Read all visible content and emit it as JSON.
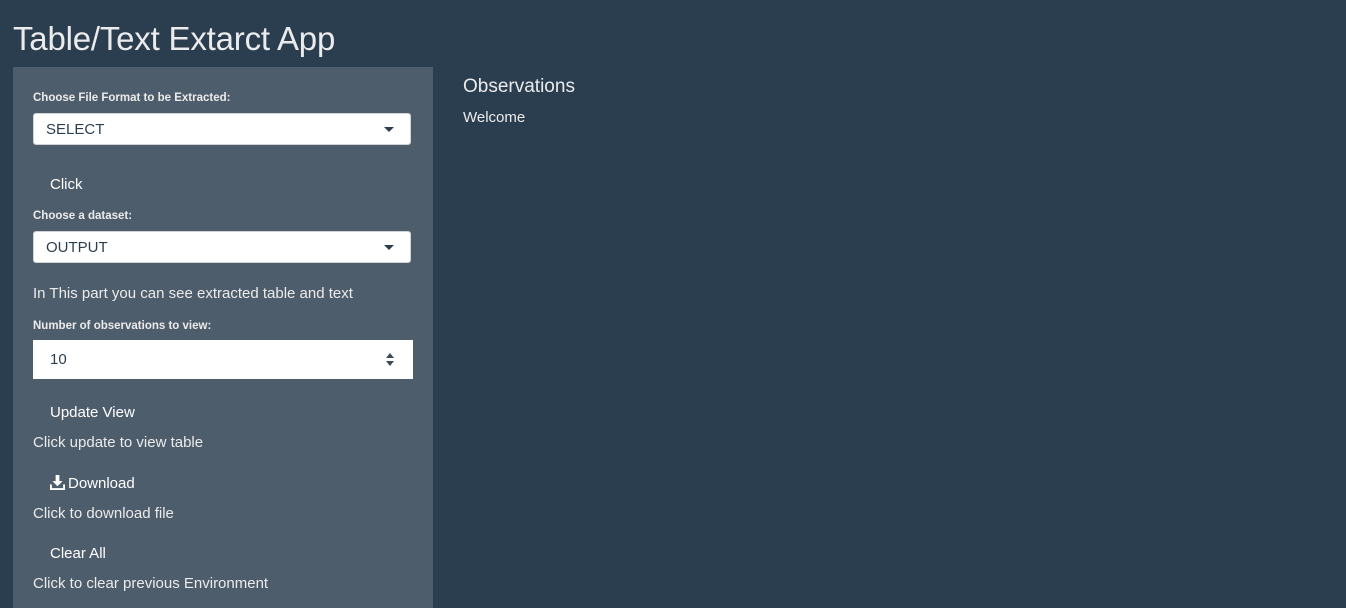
{
  "app": {
    "title": "Table/Text Extarct App"
  },
  "sidebar": {
    "file_format": {
      "label": "Choose File Format to be Extracted:",
      "selected": "SELECT"
    },
    "click_button": "Click",
    "dataset": {
      "label": "Choose a dataset:",
      "selected": "OUTPUT"
    },
    "extracted_info": "In This part you can see extracted table and text",
    "observations": {
      "label": "Number of observations to view:",
      "value": "10"
    },
    "update_button": "Update View",
    "update_help": "Click update to view table",
    "download_button": "Download",
    "download_icon": "download-icon",
    "download_help": "Click to download file",
    "clear_button": "Clear All",
    "clear_help": "Click to clear previous Environment"
  },
  "main": {
    "heading": "Observations",
    "text": "Welcome"
  },
  "colors": {
    "background": "#2b3e50",
    "sidebar": "#4e5d6c",
    "text": "#ebebeb"
  }
}
